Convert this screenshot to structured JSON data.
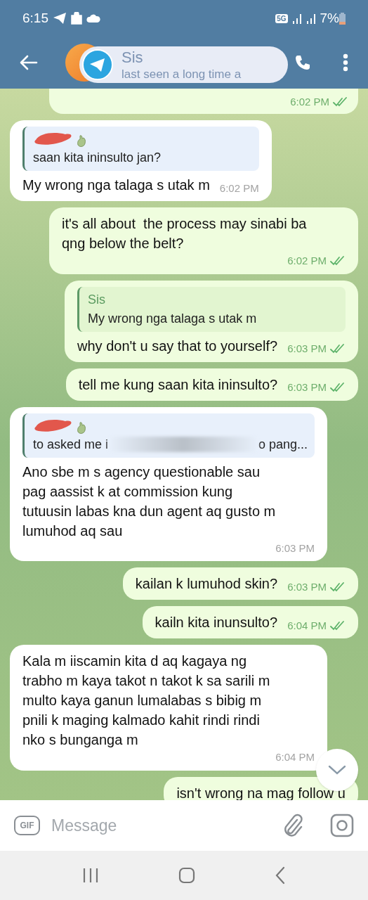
{
  "status_bar": {
    "time": "6:15",
    "network": "5G",
    "battery": "7%"
  },
  "header": {
    "title": "Sis",
    "subtitle": "last seen a long time a"
  },
  "messages": [
    {
      "kind": "outgoing",
      "partial": true,
      "time": "6:02 PM",
      "read": true
    },
    {
      "kind": "incoming",
      "reply": {
        "sender_hidden": true,
        "text_parts": [
          "saan kita ininsulto jan?"
        ]
      },
      "text": "My wrong nga talaga s utak m",
      "time": "6:02 PM"
    },
    {
      "kind": "outgoing",
      "text": "it's all about  the process may sinabi ba qng below the belt?",
      "time": "6:02 PM",
      "read": true
    },
    {
      "kind": "outgoing",
      "reply": {
        "sender": "Sis",
        "text_parts": [
          "My wrong nga talaga s utak m"
        ]
      },
      "text": "why don't u say that to yourself?",
      "time": "6:03 PM",
      "read": true
    },
    {
      "kind": "outgoing",
      "text": "tell me kung saan kita ininsulto?",
      "time": "6:03 PM",
      "read": true
    },
    {
      "kind": "incoming",
      "reply": {
        "sender_hidden": true,
        "text_parts": [
          "to asked me i",
          "o pang..."
        ]
      },
      "text": "Ano sbe m s agency questionable sau pag aassist k at commission kung tutuusin labas kna dun agent aq gusto m lumuhod aq sau",
      "time": "6:03 PM"
    },
    {
      "kind": "outgoing",
      "text": "kailan k lumuhod skin?",
      "time": "6:03 PM",
      "read": true
    },
    {
      "kind": "outgoing",
      "text": "kailn kita inunsulto?",
      "time": "6:04 PM",
      "read": true
    },
    {
      "kind": "incoming",
      "text": "Kala m iiscamin kita d aq kagaya ng trabho m kaya takot n takot k sa sarili m multo kaya ganun lumalabas s bibig m pnili k maging kalmado kahit rindi rindi nko s bunganga m",
      "time": "6:04 PM"
    },
    {
      "kind": "outgoing",
      "text": "isn't wrong na mag follow u"
    }
  ],
  "input_bar": {
    "gif_label": "GIF",
    "placeholder": "Message"
  }
}
